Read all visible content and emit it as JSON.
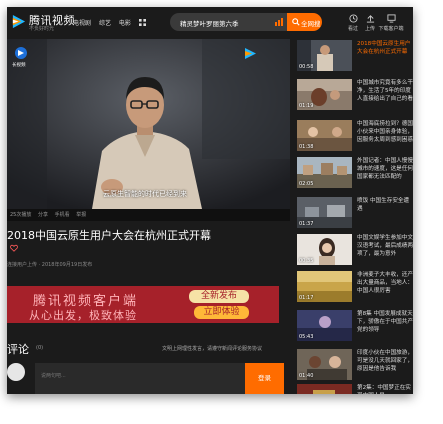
{
  "header": {
    "logo_text": "腾讯视频",
    "logo_slogan": "不负好时光",
    "nav": [
      "电视剧",
      "综艺",
      "电影"
    ],
    "search_query": "精灵梦叶罗丽第六季",
    "search_button": "全网搜",
    "tools": [
      {
        "label": "看过",
        "icon": "history-icon"
      },
      {
        "label": "上传",
        "icon": "upload-icon"
      },
      {
        "label": "下载客户端",
        "icon": "download-icon"
      }
    ]
  },
  "player": {
    "subtitle": "云原生智能的时代已经到来",
    "watermark": "长视频",
    "controls": [
      "25次播放",
      "分享",
      "手机看",
      "举报"
    ]
  },
  "video": {
    "title": "2018中国云原生用户大会在杭州正式开幕",
    "meta": "连接用户上传 · 2018年09月19日发布"
  },
  "banner": {
    "line1": "腾讯视频客户端",
    "line2": "从心出发，极致体验",
    "btn1": "全新发布",
    "btn2": "立即体验"
  },
  "comments": {
    "title": "评论",
    "count": "(0)",
    "rule": "文明上网理性发言，请遵守新闻评论服务协议",
    "placeholder": "说两句吧...",
    "submit": "登录"
  },
  "related": [
    {
      "duration": "00:58",
      "title": "2018中国云原生用户大会在杭州正式开幕",
      "active": true
    },
    {
      "duration": "01:19",
      "title": "中国城市究竟有多么干净，生活了5年的印度人直接给出了自己的看法",
      "active": false
    },
    {
      "duration": "01:38",
      "title": "中国海底捞拉到？德国小伙来中国亲身体验，因服务太周到感到困惑",
      "active": false
    },
    {
      "duration": "02:05",
      "title": "外国记者：中国人慢慢城市的速度，这是任何国家都无法匹配的",
      "active": false
    },
    {
      "duration": "01:37",
      "title": "喷饭 中国生存安全遭遇",
      "active": false
    },
    {
      "duration": "00:35",
      "title": "中国文娱学生参加中文汉语考试，最后成绩两项了，最为意外",
      "active": false
    },
    {
      "duration": "01:17",
      "title": "非洲麦子大丰收，还产出大量商品，当地人：中国人很厉害",
      "active": false
    },
    {
      "duration": "05:43",
      "title": "第8集 中国发展成就天下，骄傲在于中国共产党的领导",
      "active": false
    },
    {
      "duration": "01:40",
      "title": "印度小伙在中国旅游，可是没几天就回家了，原因是他告诉我",
      "active": false
    },
    {
      "duration": "",
      "title": "第2集：中国梦正在实现中国人民",
      "active": false
    }
  ]
}
